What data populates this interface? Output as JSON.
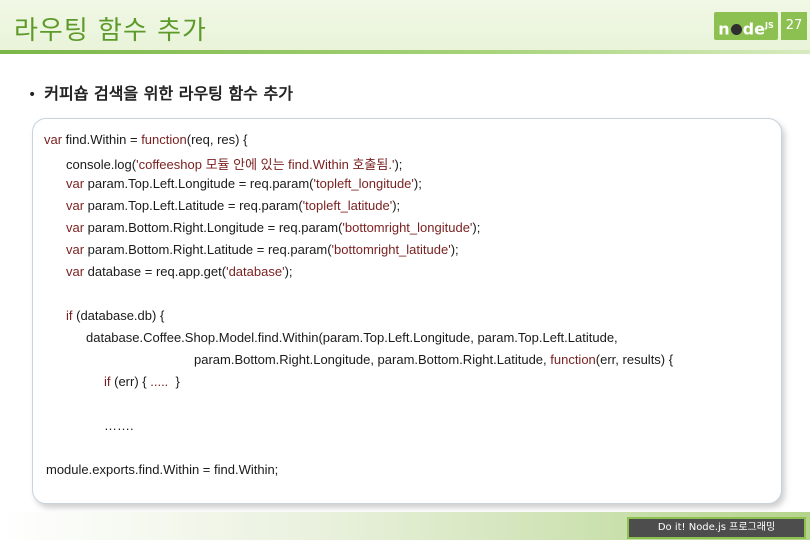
{
  "slide": {
    "title": "라우팅 함수 추가",
    "page_number": "27",
    "logo_text_left": "n",
    "logo_text_right": "de",
    "logo_suffix": "JS",
    "bullet": "커피숍 검색을 위한 라우팅 함수 추가",
    "footer": "Do it! Node.js 프로그래밍"
  },
  "code": {
    "l1_kw": "var",
    "l1_a": " find.Within = ",
    "l1_fn": "function",
    "l1_b": "(req, res) {",
    "l2_a": "console.log(",
    "l2_s": "'coffeeshop 모듈 안에 있는 find.Within 호출됨.'",
    "l2_b": ");",
    "l3_kw": "var",
    "l3_a": " param.Top.Left.Longitude = req.param(",
    "l3_s": "'topleft_longitude'",
    "l3_b": ");",
    "l4_kw": "var",
    "l4_a": " param.Top.Left.Latitude = req.param(",
    "l4_s": "'topleft_latitude'",
    "l4_b": ");",
    "l5_kw": "var",
    "l5_a": " param.Bottom.Right.Longitude = req.param(",
    "l5_s": "'bottomright_longitude'",
    "l5_b": ");",
    "l6_kw": "var",
    "l6_a": " param.Bottom.Right.Latitude = req.param(",
    "l6_s": "'bottomright_latitude'",
    "l6_b": ");",
    "l7_kw": "var",
    "l7_a": " database = req.app.get(",
    "l7_s": "'database'",
    "l7_b": ");",
    "l8_kw": "if",
    "l8_a": " (database.db) {",
    "l9": "database.Coffee.Shop.Model.find.Within(param.Top.Left.Longitude, param.Top.Left.Latitude,",
    "l10_a": "param.Bottom.Right.Longitude, param.Bottom.Right.Latitude, ",
    "l10_fn": "function",
    "l10_b": "(err, results) {",
    "l11_kw": "if",
    "l11_a": " (err) { ",
    "l11_dots": ".....",
    "l11_b": "  }",
    "l12": "…….",
    "l13": "module.exports.find.Within = find.Within;"
  }
}
